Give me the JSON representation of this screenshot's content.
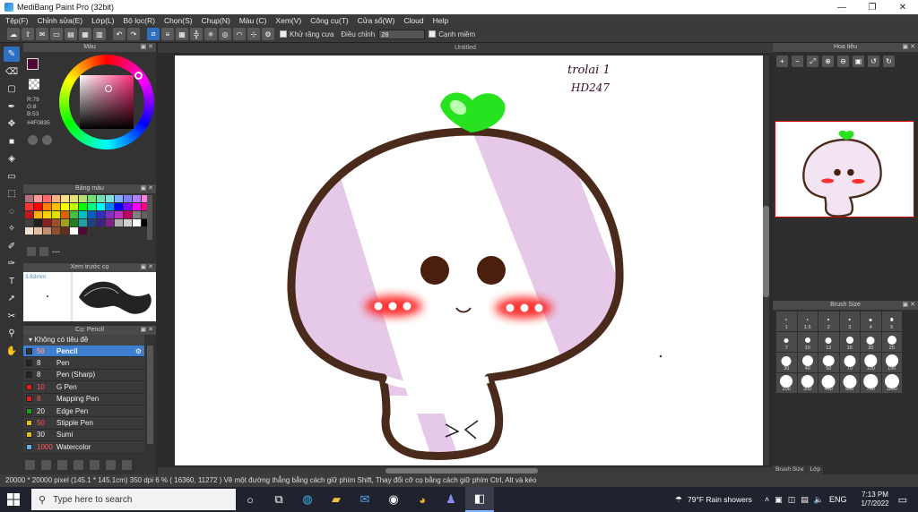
{
  "window": {
    "title": "MediBang Paint Pro (32bit)",
    "minimize": "—",
    "maximize": "❐",
    "close": "✕"
  },
  "menu": [
    "Tệp(F)",
    "Chỉnh sửa(E)",
    "Lớp(L)",
    "Bộ lọc(R)",
    "Chọn(S)",
    "Chụp(N)",
    "Màu (C)",
    "Xem(V)",
    "Công cụ(T)",
    "Cửa sổ(W)",
    "Cloud",
    "Help"
  ],
  "toolbar": {
    "antialias_label": "Khử răng cưa",
    "correction_label": "Điều chỉnh",
    "correction_value": "28",
    "edge_label": "Cạnh miềm"
  },
  "color_panel": {
    "title": "Màu",
    "r": "R:79",
    "g": "G:8",
    "b": "B:53",
    "hex": "#4F0835",
    "foreground": "#4F0835",
    "background": "#E05820"
  },
  "palette_panel": {
    "title": "Bảng màu",
    "extra": "---",
    "colors": [
      "#b07080",
      "#ff9a9a",
      "#ff6a6a",
      "#ffb080",
      "#ffe08a",
      "#e8e070",
      "#b8e070",
      "#70e070",
      "#70e0b0",
      "#80e0e0",
      "#80b0ff",
      "#8080ff",
      "#b080ff",
      "#ff80e0",
      "#ff3030",
      "#ff0000",
      "#ff8000",
      "#ffc000",
      "#ffff00",
      "#c0ff00",
      "#00ff00",
      "#00ff80",
      "#00ffff",
      "#0080ff",
      "#0000ff",
      "#8000ff",
      "#ff00ff",
      "#ff0080",
      "#c01818",
      "#ffb000",
      "#ffd000",
      "#e0e000",
      "#e06000",
      "#40c040",
      "#00c0c0",
      "#0060c0",
      "#3030c0",
      "#8030c0",
      "#c030c0",
      "#c00060",
      "#808080",
      "#606060",
      "#404040",
      "#202020",
      "#8a2020",
      "#a05020",
      "#a0a020",
      "#208020",
      "#20a0a0",
      "#204080",
      "#402080",
      "#802080",
      "#b0b0b0",
      "#d0d0d0",
      "#ffffff",
      "#000000",
      "#f0e0d0",
      "#e0c0a0",
      "#c09070",
      "#905030",
      "#603020",
      "#ffffff",
      "#4f0835"
    ]
  },
  "preview_panel": {
    "title": "Xem trước cọ",
    "size": "3.63mm"
  },
  "brush_panel": {
    "title": "Cọ: Pencil",
    "group": "Không có tiêu đề",
    "brushes": [
      {
        "size": "50",
        "name": "Pencil",
        "color": "#333333",
        "selected": true,
        "size_white": false
      },
      {
        "size": "8",
        "name": "Pen",
        "color": "#222222",
        "selected": false,
        "size_white": true
      },
      {
        "size": "8",
        "name": "Pen (Sharp)",
        "color": "#222222",
        "selected": false,
        "size_white": true
      },
      {
        "size": "10",
        "name": "G Pen",
        "color": "#e02020",
        "selected": false,
        "size_white": false
      },
      {
        "size": "8",
        "name": "Mapping Pen",
        "color": "#e02020",
        "selected": false,
        "size_white": false
      },
      {
        "size": "20",
        "name": "Edge Pen",
        "color": "#20a020",
        "selected": false,
        "size_white": true
      },
      {
        "size": "50",
        "name": "Stipple Pen",
        "color": "#e0c020",
        "selected": false,
        "size_white": false
      },
      {
        "size": "30",
        "name": "Sumi",
        "color": "#e0c020",
        "selected": false,
        "size_white": true
      },
      {
        "size": "1000",
        "name": "Watercolor",
        "color": "#60b0e0",
        "selected": false,
        "size_white": false
      }
    ]
  },
  "canvas": {
    "tab": "Untitled",
    "handwriting_line1": "trolai 1",
    "handwriting_line2": "HD247"
  },
  "navigator": {
    "title": "Hoa tiêu"
  },
  "brush_size_panel": {
    "title": "Brush Size",
    "sizes": [
      "1",
      "1.5",
      "2",
      "3",
      "4",
      "5",
      "7",
      "10",
      "12",
      "15",
      "20",
      "25",
      "30",
      "40",
      "50",
      "70",
      "100",
      "150",
      "200",
      "300",
      "400",
      "500",
      "700",
      "1000"
    ],
    "tabs": [
      "Brush Size",
      "Lớp"
    ]
  },
  "status": {
    "text": "20000 * 20000 pixel   (145.1 * 145.1cm)   350 dpi   6 %   ( 16360, 11272 )   Vẽ một đường thẳng bằng cách giữ phím Shift, Thay đổi cỡ cọ bằng cách giữ phím Ctrl, Alt và kéo"
  },
  "taskbar": {
    "search_placeholder": "Type here to search",
    "weather": "79°F  Rain showers",
    "lang": "ENG",
    "time": "7:13 PM",
    "date": "1/7/2022"
  }
}
